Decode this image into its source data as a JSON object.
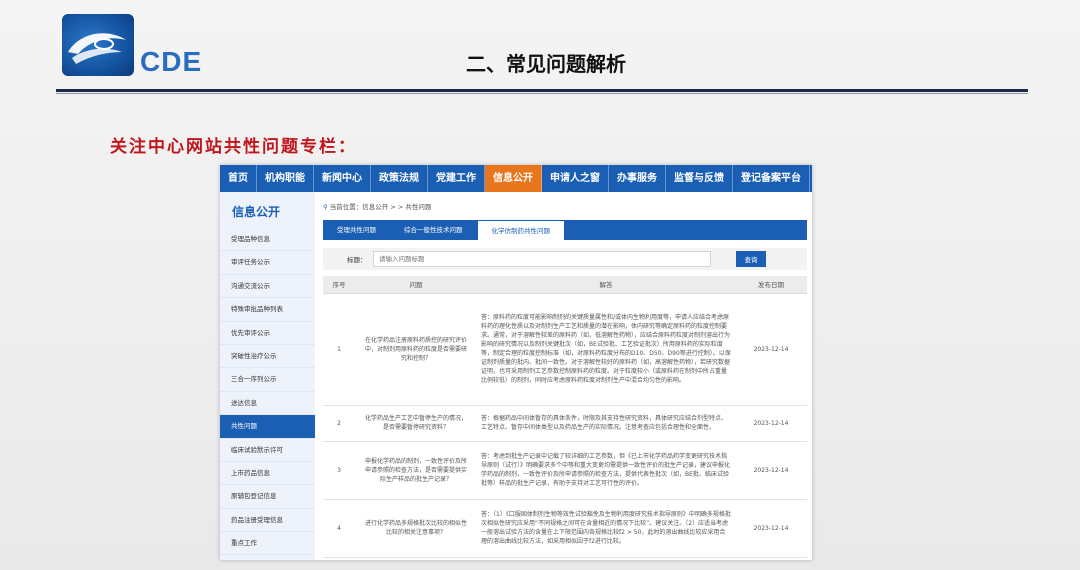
{
  "slide": {
    "logo_text": "CDE",
    "title": "二、常见问题解析",
    "subheading": "关注中心网站共性问题专栏："
  },
  "topnav": [
    {
      "label": "首页",
      "active": false
    },
    {
      "label": "机构职能",
      "active": false
    },
    {
      "label": "新闻中心",
      "active": false
    },
    {
      "label": "政策法规",
      "active": false
    },
    {
      "label": "党建工作",
      "active": false
    },
    {
      "label": "信息公开",
      "active": true
    },
    {
      "label": "申请人之窗",
      "active": false
    },
    {
      "label": "办事服务",
      "active": false
    },
    {
      "label": "监督与反馈",
      "active": false
    },
    {
      "label": "登记备案平台",
      "active": false
    }
  ],
  "leftnav": {
    "heading": "信息公开",
    "items": [
      {
        "label": "受理品种信息",
        "active": false
      },
      {
        "label": "审评任务公示",
        "active": false
      },
      {
        "label": "沟通交流公示",
        "active": false
      },
      {
        "label": "特殊审批品种列表",
        "active": false
      },
      {
        "label": "优先审评公示",
        "active": false
      },
      {
        "label": "突破性治疗公示",
        "active": false
      },
      {
        "label": "三合一序列公示",
        "active": false
      },
      {
        "label": "送达信息",
        "active": false
      },
      {
        "label": "共性问题",
        "active": true
      },
      {
        "label": "临床试验默示许可",
        "active": false
      },
      {
        "label": "上市药品信息",
        "active": false
      },
      {
        "label": "原辅包登记信息",
        "active": false
      },
      {
        "label": "药品注册受理信息",
        "active": false
      },
      {
        "label": "重点工作",
        "active": false
      }
    ]
  },
  "breadcrumb": "当前位置：信息公开 > > 共性问题",
  "tabs": [
    {
      "label": "受理共性问题",
      "active": false
    },
    {
      "label": "综合一般性技术问题",
      "active": false
    },
    {
      "label": "化学仿制药共性问题",
      "active": true
    }
  ],
  "search": {
    "label": "标题：",
    "placeholder": "请输入问题标题",
    "button": "查询"
  },
  "table": {
    "headers": [
      "序号",
      "问题",
      "解答",
      "发布日期"
    ],
    "rows": [
      {
        "no": "1",
        "question": "在化学药品注册原料药质控的研究评价中，对制剂用原料药的粒度是否需要研究和控制？",
        "answer": "答：原料药的粒度可能影响制剂的关键质量属性和/或体内生物利用度等，申请人应结合考虑原料药的理化性质以及对制剂生产工艺和质量的潜在影响，体内研究等确定原料药的粒度控制要求。通常，对于溶解性较差的原料药（如，低溶解性药物），应结合原料药粒度对制剂溶出行为影响的研究情况以及制剂关键批次（如，BE试验批、工艺验证批次）所用原料药的实际粒度等，制定合理的粒度控制标准（如，对原料药粒度分布的D10、D50、D90等进行控制）。以保证制剂质量的批内、批间一致性。对于溶解性较好的原料药（如，高溶解性药物），若研究数据证明，也可采用制剂工艺参数控制原料药的粒度。对于粒度较小（或原料药在制剂中所占重量比例较低）的制剂，同时应考虑原料药粒度对制剂生产中混合均匀性的影响。",
        "date": "2023-12-14"
      },
      {
        "no": "2",
        "question": "化学药品生产工艺中暂停生产的情况，是否需要暂停研究资料？",
        "answer": "答：根据药品中间体暂存的具体条件，时限及其支持性研究资料，具体研究应结合剂型特点、工艺特点、暂存中间体类型以及药品生产的实际情况。注意考查应包括合理性和全面性。",
        "date": "2023-12-14"
      },
      {
        "no": "3",
        "question": "申报化学药品的制剂，一致性评价及所申请参照的检查方法，是否需要提供实际生产样品的批生产记录？",
        "answer": "答：考虑到批生产记录中记载了较详细的工艺参数，但《已上市化学药品药学变更研究技术指导原则（试行）》明确要求多个中等和重大变更均需提供一致性评价的批生产记录，建议申报化学药品的制剂，一致性评价及所申请参照的检查方法，提供代表性批次（如，BE批、临床试验批等）样品的批生产记录，有助于支持对工艺可行性的评价。",
        "date": "2023-12-14"
      },
      {
        "no": "4",
        "question": "进行化学药品多规格批次比较的相似性比较的相关注意事项？",
        "answer": "答：（1）《口服固体制剂生物等效性试验豁免及生物利用度研究技术指导原则》中明确多规格批次相似性研究应采用“不同规格之间可在含量相近的情况下比较”。建议关注。（2）应适当考虑一般溶出试验方法的含量在上下限范围内各规格比较f2 > 50，此时的溶出曲线比较应采用合理的溶出曲线比较方法，如采用相似因子f2进行比较。",
        "date": "2023-12-14"
      }
    ]
  }
}
